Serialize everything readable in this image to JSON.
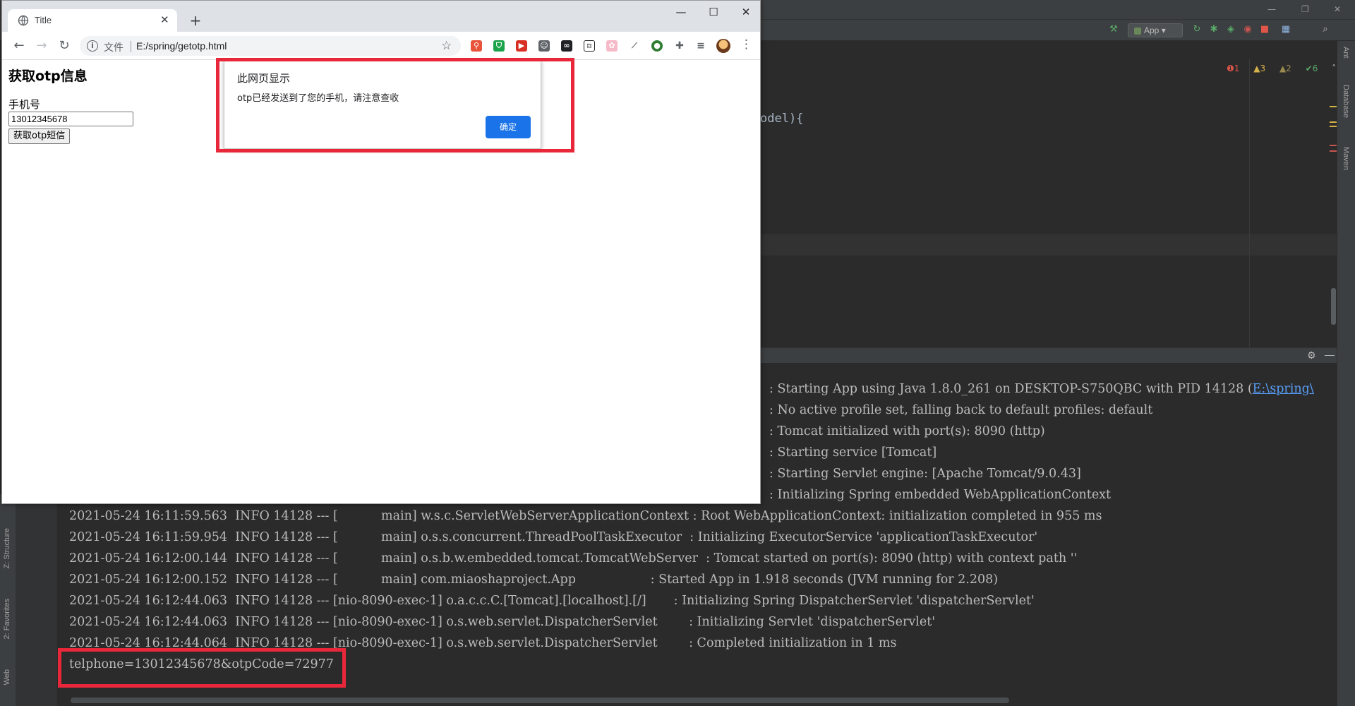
{
  "browser": {
    "tab_title": "Title",
    "url_scheme_label": "文件",
    "url": "E:/spring/getotp.html"
  },
  "page": {
    "heading": "获取otp信息",
    "phone_label": "手机号",
    "phone_value": "13012345678",
    "button_label": "获取otp短信"
  },
  "dialog": {
    "title": "此网页显示",
    "message": "otp已经发送到了您的手机，请注意查收",
    "ok_label": "确定"
  },
  "ide": {
    "run_config": "App",
    "inspections": {
      "errors": "1",
      "warnings": "3",
      "weak_warnings": "2",
      "ok": "6"
    },
    "code_fragment": "odel){",
    "right_tools": [
      "Ant",
      "Database",
      "Maven"
    ],
    "left_tools": [
      "Z: Structure",
      "2: Favorites",
      "Web"
    ]
  },
  "console": {
    "partial_lines": [
      ": Starting App using Java 1.8.0_261 on DESKTOP-S750QBC with PID 14128 (",
      ": No active profile set, falling back to default profiles: default",
      ": Tomcat initialized with port(s): 8090 (http)",
      ": Starting service [Tomcat]",
      ": Starting Servlet engine: [Apache Tomcat/9.0.43]",
      ": Initializing Spring embedded WebApplicationContext"
    ],
    "partial_link": "E:\\spring\\",
    "full_lines": [
      "2021-05-24 16:11:59.563  INFO 14128 --- [           main] w.s.c.ServletWebServerApplicationContext : Root WebApplicationContext: initialization completed in 955 ms",
      "2021-05-24 16:11:59.954  INFO 14128 --- [           main] o.s.s.concurrent.ThreadPoolTaskExecutor  : Initializing ExecutorService 'applicationTaskExecutor'",
      "2021-05-24 16:12:00.144  INFO 14128 --- [           main] o.s.b.w.embedded.tomcat.TomcatWebServer  : Tomcat started on port(s): 8090 (http) with context path ''",
      "2021-05-24 16:12:00.152  INFO 14128 --- [           main] com.miaoshaproject.App                   : Started App in 1.918 seconds (JVM running for 2.208)",
      "2021-05-24 16:12:44.063  INFO 14128 --- [nio-8090-exec-1] o.a.c.c.C.[Tomcat].[localhost].[/]       : Initializing Spring DispatcherServlet 'dispatcherServlet'",
      "2021-05-24 16:12:44.063  INFO 14128 --- [nio-8090-exec-1] o.s.web.servlet.DispatcherServlet        : Initializing Servlet 'dispatcherServlet'",
      "2021-05-24 16:12:44.064  INFO 14128 --- [nio-8090-exec-1] o.s.web.servlet.DispatcherServlet        : Completed initialization in 1 ms"
    ],
    "otp_output": "telphone=13012345678&otpCode=72977"
  },
  "colors": {
    "highlight": "#e8283a",
    "dialog_button": "#1a73e8",
    "ide_bg": "#2b2b2b"
  }
}
